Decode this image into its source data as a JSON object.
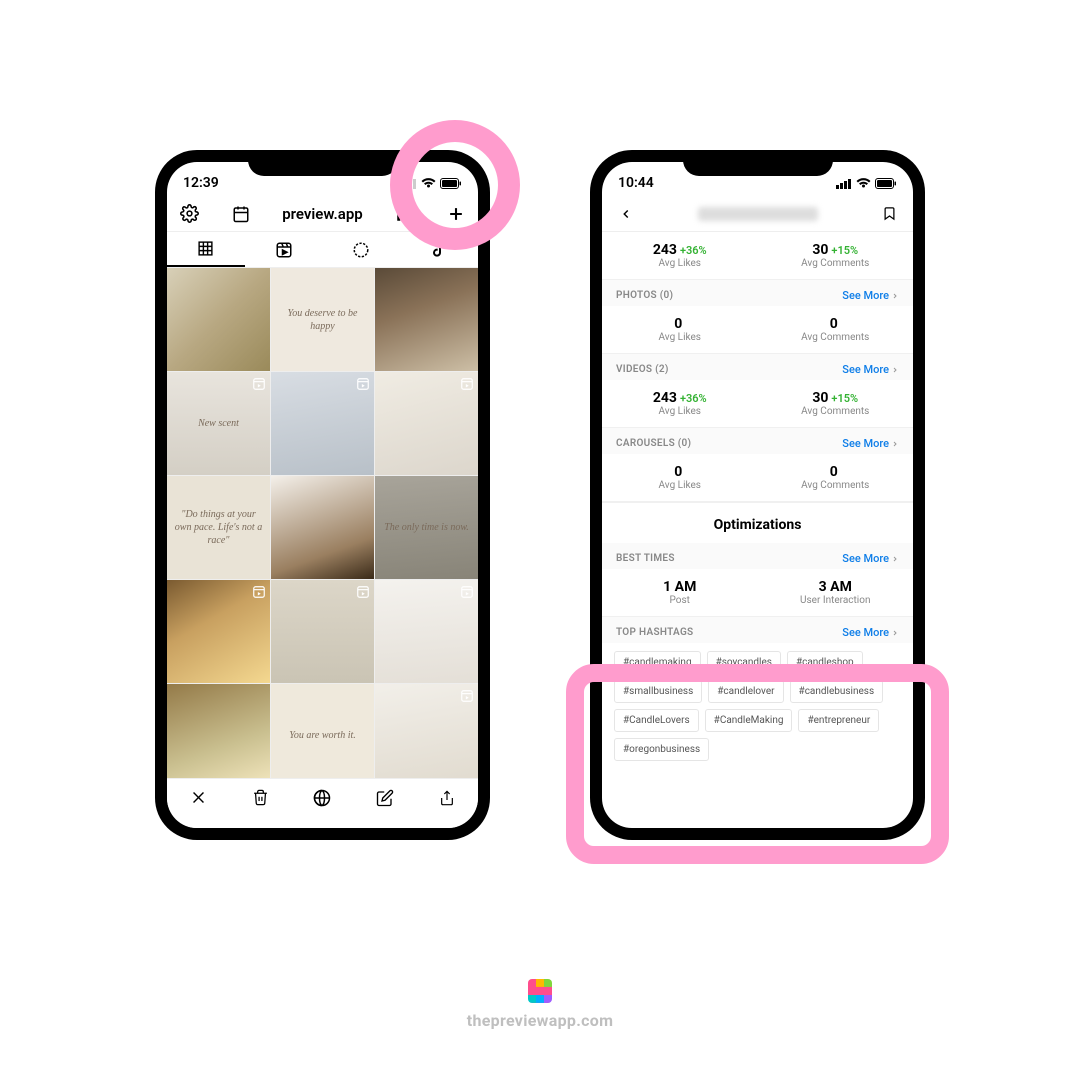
{
  "footer": {
    "text": "thepreviewapp.com"
  },
  "phone1": {
    "status": {
      "time": "12:39"
    },
    "header": {
      "title": "preview.app"
    },
    "grid": {
      "items": [
        {
          "quote": ""
        },
        {
          "quote": "You deserve to be happy"
        },
        {
          "quote": ""
        },
        {
          "quote": "New scent",
          "reel": true
        },
        {
          "quote": "",
          "reel": true
        },
        {
          "quote": "",
          "reel": true
        },
        {
          "quote": "\"Do things at your own pace. Life's not a race\""
        },
        {
          "quote": ""
        },
        {
          "quote": "The only time is now."
        },
        {
          "quote": "",
          "reel": true
        },
        {
          "quote": "",
          "reel": true
        },
        {
          "quote": "",
          "reel": true
        },
        {
          "quote": ""
        },
        {
          "quote": "You are worth it."
        },
        {
          "quote": "",
          "reel": true
        }
      ]
    }
  },
  "phone2": {
    "status": {
      "time": "10:44"
    },
    "topStats": {
      "likes": {
        "value": "243",
        "pct": "+36%",
        "label": "Avg Likes"
      },
      "comments": {
        "value": "30",
        "pct": "+15%",
        "label": "Avg Comments"
      }
    },
    "sections": [
      {
        "title": "PHOTOS (0)",
        "seeMore": "See More",
        "likes": {
          "value": "0",
          "pct": "",
          "label": "Avg Likes"
        },
        "comments": {
          "value": "0",
          "pct": "",
          "label": "Avg Comments"
        }
      },
      {
        "title": "VIDEOS (2)",
        "seeMore": "See More",
        "likes": {
          "value": "243",
          "pct": "+36%",
          "label": "Avg Likes"
        },
        "comments": {
          "value": "30",
          "pct": "+15%",
          "label": "Avg Comments"
        }
      },
      {
        "title": "CAROUSELS (0)",
        "seeMore": "See More",
        "likes": {
          "value": "0",
          "pct": "",
          "label": "Avg Likes"
        },
        "comments": {
          "value": "0",
          "pct": "",
          "label": "Avg Comments"
        }
      }
    ],
    "optimizations": {
      "title": "Optimizations"
    },
    "bestTimes": {
      "title": "BEST TIMES",
      "seeMore": "See More",
      "left": {
        "value": "1 AM",
        "label": "Post"
      },
      "right": {
        "value": "3 AM",
        "label": "User Interaction"
      }
    },
    "topHashtags": {
      "title": "TOP HASHTAGS",
      "seeMore": "See More",
      "tags": [
        "#candlemaking",
        "#soycandles",
        "#candleshop",
        "#smallbusiness",
        "#candlelover",
        "#candlebusiness",
        "#CandleLovers",
        "#CandleMaking",
        "#entrepreneur",
        "#oregonbusiness"
      ]
    }
  }
}
